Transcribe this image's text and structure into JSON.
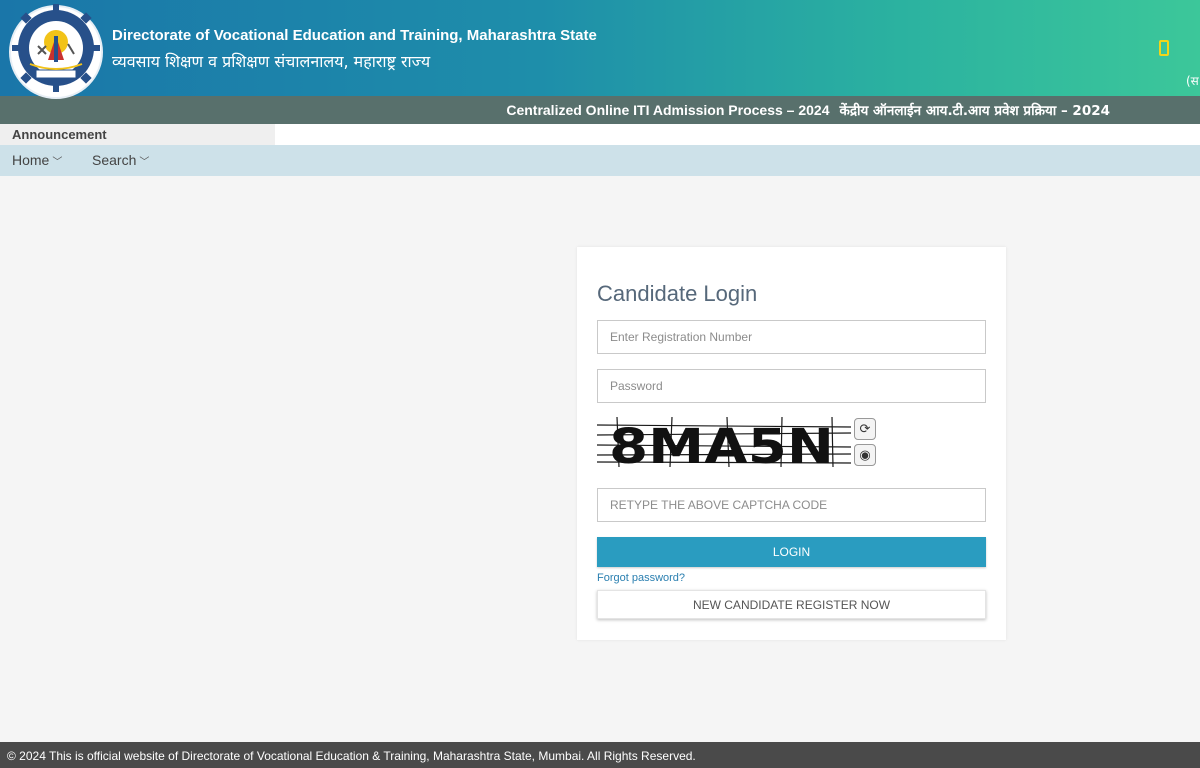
{
  "header": {
    "title_en": "Directorate of Vocational Education and Training, Maharashtra State",
    "title_mr": "व्यवसाय शिक्षण व प्रशिक्षण संचालनालय, महाराष्ट्र राज्य",
    "right_cut_text": "(स",
    "phone_icon": "mobile-phone-icon",
    "phone_icon_color": "#f2d51a"
  },
  "subbar": {
    "text_en": "Centralized Online ITI Admission Process – 2024",
    "text_mr": "केंद्रीय ऑनलाईन आय.टी.आय प्रवेश प्रक्रिया – 2024"
  },
  "announcement": {
    "label": "Announcement"
  },
  "nav": {
    "items": [
      {
        "label": "Home"
      },
      {
        "label": "Search"
      }
    ]
  },
  "login": {
    "title": "Candidate Login",
    "registration_placeholder": "Enter Registration Number",
    "password_placeholder": "Password",
    "captcha_text": "8MA5N",
    "captcha_placeholder": "RETYPE THE ABOVE CAPTCHA CODE",
    "login_label": "LOGIN",
    "forgot_label": "Forgot password?",
    "register_label": "NEW CANDIDATE REGISTER NOW"
  },
  "footer": {
    "text": "© 2024 This is official website of Directorate of Vocational Education & Training, Maharashtra State, Mumbai. All Rights Reserved."
  },
  "colors": {
    "header_start": "#1a76a9",
    "header_end": "#3cc79a",
    "subbar": "#58706c",
    "navbar": "#cde1e9",
    "login_button": "#2a9cc0",
    "footer": "#4a4a4a"
  }
}
